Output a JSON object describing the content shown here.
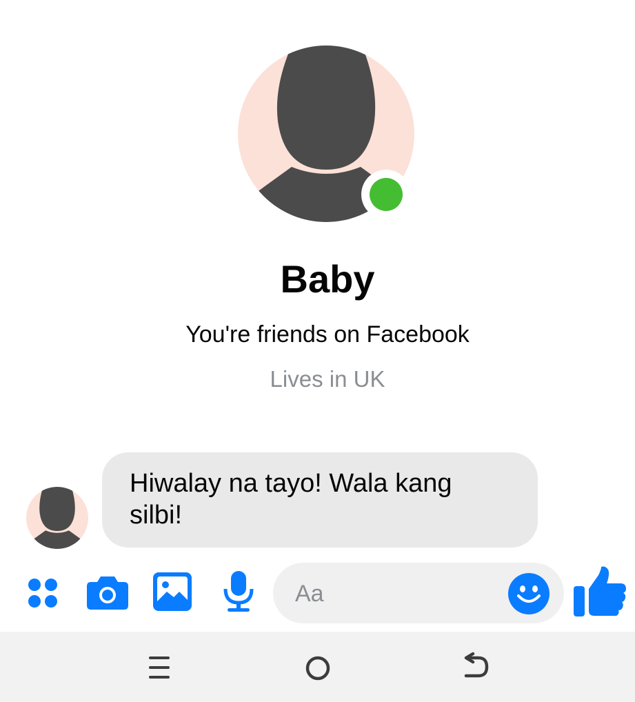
{
  "contact": {
    "name": "Baby",
    "friend_status": "You're friends on Facebook",
    "location": "Lives in UK",
    "online": true
  },
  "messages": [
    {
      "from": "contact",
      "text": "Hiwalay na tayo! Wala kang silbi!"
    }
  ],
  "composer": {
    "placeholder": "Aa",
    "tools": [
      "apps-icon",
      "camera-icon",
      "gallery-icon",
      "microphone-icon"
    ],
    "emoji_icon": "emoji-icon",
    "send_icon": "thumbs-up-icon"
  },
  "navigation": {
    "buttons": [
      "recents-icon",
      "home-icon",
      "back-icon"
    ]
  },
  "colors": {
    "accent": "#0a7cff",
    "online": "#44bd32",
    "avatar_bg": "#fce1d8",
    "avatar_fg": "#4b4b4b",
    "bubble": "#e9e9ea"
  }
}
